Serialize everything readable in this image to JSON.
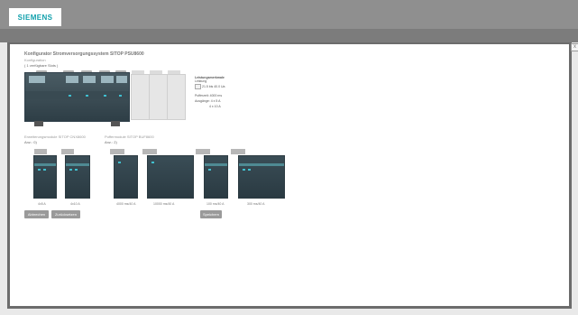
{
  "header": {
    "brand": "SIEMENS"
  },
  "dialog": {
    "close_label": "x",
    "title": "Konfigurator Stromversorgungssystem SITOP PSU8600",
    "subtitle": "Konfiguration",
    "config_note": "( 1 verfügbare Slots )"
  },
  "specs": {
    "heading": "Leistungsmerkmale",
    "label_voltage": "Leistung",
    "voltage_value": "21.5 bis 40.0 Ua",
    "total_current": "Pufferzeit: 4000 ms",
    "outputs_1": "Ausgänge: 4 x 5 A",
    "outputs_2": "4 x 10 A"
  },
  "sections": {
    "extension_title": "Erweiterungsmodule SITOP CNX8600",
    "extension_count": "Anz.: 0)",
    "buffer_title": "Puffermodule SITOP BUF8600",
    "buffer_count": "Anz.: 2)"
  },
  "modules": [
    {
      "label": "4x5 A"
    },
    {
      "label": "4x10 A"
    },
    {
      "label": "4000 ms/40 A"
    },
    {
      "label": "10000 ms/40 A"
    },
    {
      "label": "100 ms/40 A"
    },
    {
      "label": "300 ms/40 A"
    }
  ],
  "buttons": {
    "remove": "Abbrechen",
    "reset": "Zurücksetzen",
    "save": "Speichern"
  },
  "colors": {
    "brand": "#0f9fab",
    "header_gray": "#8f8f8f",
    "frame": "#6c6c6c",
    "module_body": "#2e3e46",
    "led": "#3fbfd0"
  }
}
